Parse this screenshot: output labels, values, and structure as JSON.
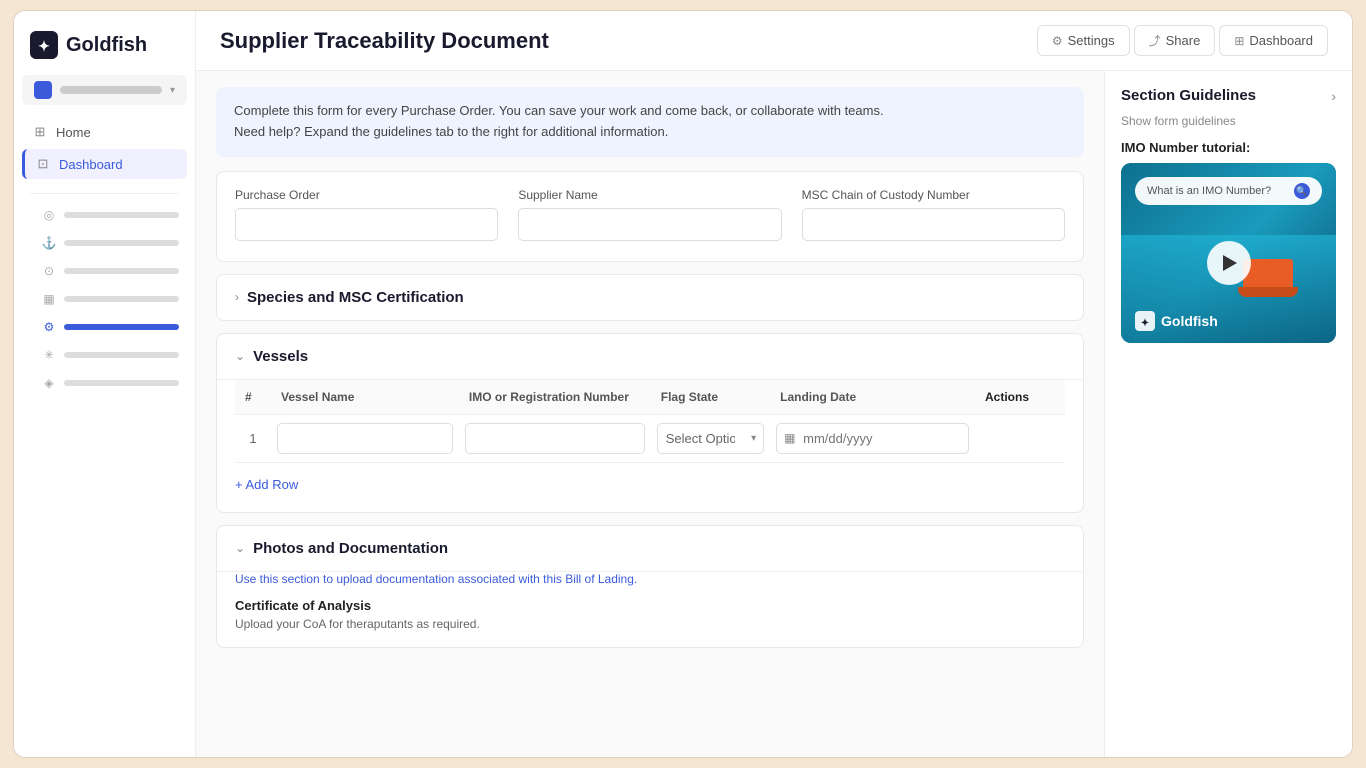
{
  "app": {
    "name": "Goldfish",
    "logo_unicode": "✦"
  },
  "workspace": {
    "placeholder_bars": 3
  },
  "sidebar": {
    "nav_items": [
      {
        "id": "home",
        "label": "Home",
        "icon": "⊞",
        "active": false
      },
      {
        "id": "dashboard",
        "label": "Dashboard",
        "icon": "⊡",
        "active": true
      }
    ],
    "sub_items": [
      {
        "id": "sub1",
        "icon": "◎",
        "active": false
      },
      {
        "id": "sub2",
        "icon": "⚓",
        "active": false
      },
      {
        "id": "sub3",
        "icon": "⊙",
        "active": false
      },
      {
        "id": "sub4",
        "icon": "▦",
        "active": false
      },
      {
        "id": "sub5",
        "icon": "⚙",
        "active": true
      },
      {
        "id": "sub6",
        "icon": "✳",
        "active": false
      },
      {
        "id": "sub7",
        "icon": "◈",
        "active": false
      }
    ]
  },
  "header": {
    "title": "Supplier Traceability Document",
    "toolbar": {
      "settings_label": "Settings",
      "share_label": "Share",
      "dashboard_label": "Dashboard"
    }
  },
  "info_banner": {
    "line1": "Complete this form for every Purchase Order.  You can save your work and come back, or collaborate with teams.",
    "line2": "Need help? Expand the guidelines tab to the right for additional information."
  },
  "basic_fields": {
    "purchase_order": {
      "label": "Purchase Order",
      "placeholder": ""
    },
    "supplier_name": {
      "label": "Supplier Name",
      "placeholder": ""
    },
    "msc_chain": {
      "label": "MSC Chain of Custody Number",
      "placeholder": ""
    }
  },
  "sections": {
    "species": {
      "title": "Species and MSC Certification",
      "expanded": false
    },
    "vessels": {
      "title": "Vessels",
      "expanded": true,
      "table": {
        "columns": {
          "hash": "#",
          "vessel_name": "Vessel Name",
          "imo": "IMO or Registration Number",
          "flag_state": "Flag State",
          "landing_date": "Landing Date",
          "actions": "Actions"
        },
        "rows": [
          {
            "num": "1",
            "vessel_name_value": "",
            "imo_value": "",
            "flag_state_placeholder": "Select Option",
            "landing_date_placeholder": "mm/dd/yyyy"
          }
        ]
      },
      "add_row_label": "+ Add Row"
    },
    "photos": {
      "title": "Photos and Documentation",
      "expanded": true,
      "description": "Use this section to upload documentation associated with this Bill of Lading.",
      "certificate": {
        "title": "Certificate of Analysis",
        "description": "Upload your CoA for theraputants as required."
      }
    }
  },
  "guidelines_panel": {
    "title": "Section Guidelines",
    "show_link": "Show form guidelines",
    "imo_tutorial": {
      "label": "IMO Number tutorial:",
      "search_placeholder": "What is an IMO Number?",
      "logo_text": "Goldfish"
    }
  }
}
